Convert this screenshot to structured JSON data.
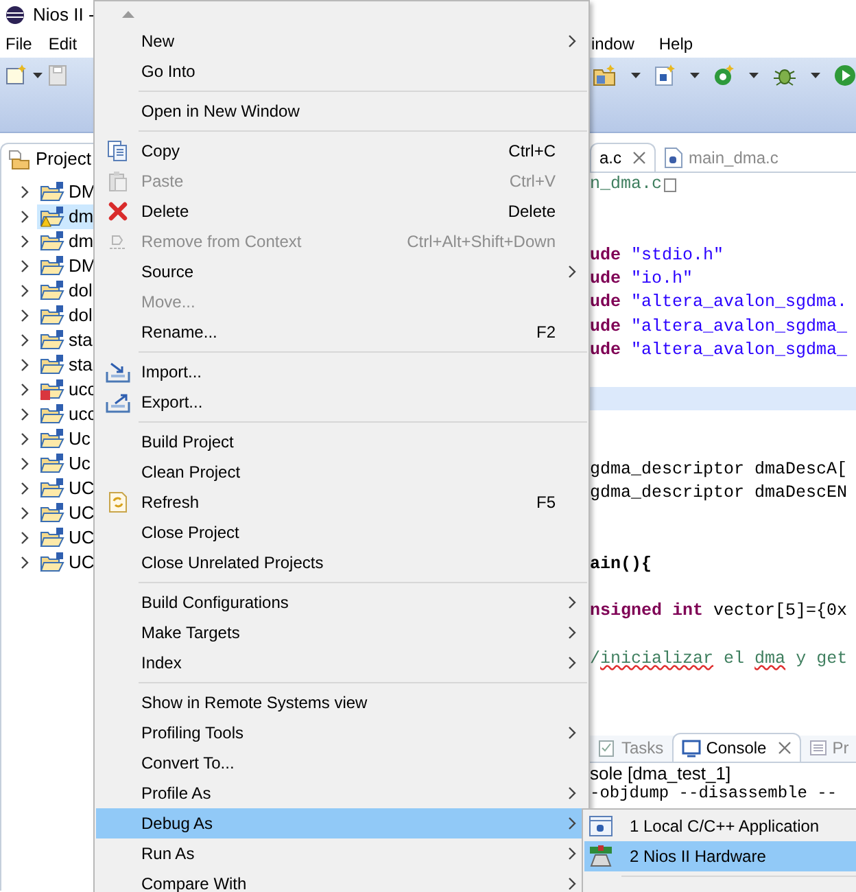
{
  "window": {
    "title": "Nios II -"
  },
  "menubar": [
    {
      "label": "File"
    },
    {
      "label": "Edit"
    },
    {
      "label": "indow"
    },
    {
      "label": "Help"
    }
  ],
  "project_panel": {
    "tab": "Project",
    "tree": [
      {
        "label": "DM",
        "selected": false,
        "kind": "normal"
      },
      {
        "label": "dm",
        "selected": true,
        "kind": "warning"
      },
      {
        "label": "dm",
        "selected": false,
        "kind": "normal"
      },
      {
        "label": "DM",
        "selected": false,
        "kind": "normal"
      },
      {
        "label": "dol",
        "selected": false,
        "kind": "normal"
      },
      {
        "label": "dol",
        "selected": false,
        "kind": "normal"
      },
      {
        "label": "sta",
        "selected": false,
        "kind": "normal"
      },
      {
        "label": "sta",
        "selected": false,
        "kind": "normal"
      },
      {
        "label": "ucc",
        "selected": false,
        "kind": "error"
      },
      {
        "label": "ucc",
        "selected": false,
        "kind": "normal"
      },
      {
        "label": "Uc",
        "selected": false,
        "kind": "normal"
      },
      {
        "label": "Uc",
        "selected": false,
        "kind": "normal"
      },
      {
        "label": "UC",
        "selected": false,
        "kind": "normal"
      },
      {
        "label": "UC",
        "selected": false,
        "kind": "normal"
      },
      {
        "label": "UC",
        "selected": false,
        "kind": "normal"
      },
      {
        "label": "UC",
        "selected": false,
        "kind": "normal"
      }
    ]
  },
  "editor": {
    "tabs": [
      {
        "label": "a.c",
        "selected": true
      },
      {
        "label": "main_dma.c",
        "selected": false
      }
    ],
    "lines": [
      {
        "kind": "folded",
        "highlighted": false,
        "segments": [
          {
            "text": "n_dma.c",
            "kind": "comment"
          }
        ]
      },
      {
        "kind": "blank",
        "highlighted": false
      },
      {
        "kind": "blank",
        "highlighted": false
      },
      {
        "kind": "code",
        "highlighted": false,
        "segments": [
          {
            "text": "ude",
            "kind": "keyword"
          },
          {
            "text": " \"stdio.h\"",
            "kind": "string"
          }
        ]
      },
      {
        "kind": "code",
        "highlighted": false,
        "segments": [
          {
            "text": "ude",
            "kind": "keyword"
          },
          {
            "text": " \"io.h\"",
            "kind": "string"
          }
        ]
      },
      {
        "kind": "code",
        "highlighted": false,
        "segments": [
          {
            "text": "ude",
            "kind": "keyword"
          },
          {
            "text": " \"altera_avalon_sgdma.",
            "kind": "string"
          }
        ]
      },
      {
        "kind": "code",
        "highlighted": false,
        "segments": [
          {
            "text": "ude",
            "kind": "keyword"
          },
          {
            "text": " \"altera_avalon_sgdma_",
            "kind": "string"
          }
        ]
      },
      {
        "kind": "code",
        "highlighted": false,
        "segments": [
          {
            "text": "ude",
            "kind": "keyword"
          },
          {
            "text": " \"altera_avalon_sgdma_",
            "kind": "string"
          }
        ]
      },
      {
        "kind": "blank",
        "highlighted": false
      },
      {
        "kind": "blank",
        "highlighted": true
      },
      {
        "kind": "blank",
        "highlighted": false
      },
      {
        "kind": "blank",
        "highlighted": false
      },
      {
        "kind": "code",
        "highlighted": false,
        "segments": [
          {
            "text": "gdma_descriptor dmaDescA[",
            "kind": "plain"
          }
        ]
      },
      {
        "kind": "code",
        "highlighted": false,
        "segments": [
          {
            "text": "gdma_descriptor dmaDescEN",
            "kind": "plain"
          }
        ]
      },
      {
        "kind": "blank",
        "highlighted": false
      },
      {
        "kind": "blank",
        "highlighted": false
      },
      {
        "kind": "code",
        "highlighted": false,
        "segments": [
          {
            "text": "ain(){",
            "kind": "bold"
          }
        ]
      },
      {
        "kind": "blank",
        "highlighted": false
      },
      {
        "kind": "code",
        "highlighted": false,
        "segments": [
          {
            "text": "nsigned int",
            "kind": "keyword"
          },
          {
            "text": " vector[5]={0x",
            "kind": "plain"
          }
        ]
      },
      {
        "kind": "blank",
        "highlighted": false
      },
      {
        "kind": "code",
        "highlighted": false,
        "segments": [
          {
            "text": "/",
            "kind": "comment"
          },
          {
            "text": "inicializar",
            "kind": "misspelled"
          },
          {
            "text": " el ",
            "kind": "comment"
          },
          {
            "text": "dma",
            "kind": "misspelled"
          },
          {
            "text": " y get",
            "kind": "comment"
          }
        ]
      }
    ]
  },
  "bottom_panel": {
    "tabs": [
      {
        "label": "Tasks",
        "selected": false
      },
      {
        "label": "Console",
        "selected": true
      },
      {
        "label": "Pr",
        "selected": false
      }
    ],
    "console_title": "sole [dma_test_1]",
    "console_lines": [
      "-objdump --disassemble --"
    ]
  },
  "context_menu": {
    "items": [
      {
        "kind": "item",
        "label": "New",
        "submenu": true,
        "disabled": false,
        "selected": false
      },
      {
        "kind": "item",
        "label": "Go Into",
        "submenu": false,
        "disabled": false,
        "selected": false
      },
      {
        "kind": "separator"
      },
      {
        "kind": "item",
        "label": "Open in New Window",
        "submenu": false,
        "disabled": false,
        "selected": false
      },
      {
        "kind": "separator"
      },
      {
        "kind": "item",
        "label": "Copy",
        "shortcut": "Ctrl+C",
        "submenu": false,
        "disabled": false,
        "selected": false
      },
      {
        "kind": "item",
        "label": "Paste",
        "shortcut": "Ctrl+V",
        "submenu": false,
        "disabled": true,
        "selected": false
      },
      {
        "kind": "item",
        "label": "Delete",
        "shortcut": "Delete",
        "submenu": false,
        "disabled": false,
        "selected": false
      },
      {
        "kind": "item",
        "label": "Remove from Context",
        "shortcut": "Ctrl+Alt+Shift+Down",
        "submenu": false,
        "disabled": true,
        "selected": false
      },
      {
        "kind": "item",
        "label": "Source",
        "submenu": true,
        "disabled": false,
        "selected": false
      },
      {
        "kind": "item",
        "label": "Move...",
        "submenu": false,
        "disabled": true,
        "selected": false
      },
      {
        "kind": "item",
        "label": "Rename...",
        "shortcut": "F2",
        "submenu": false,
        "disabled": false,
        "selected": false
      },
      {
        "kind": "separator"
      },
      {
        "kind": "item",
        "label": "Import...",
        "submenu": false,
        "disabled": false,
        "selected": false
      },
      {
        "kind": "item",
        "label": "Export...",
        "submenu": false,
        "disabled": false,
        "selected": false
      },
      {
        "kind": "separator"
      },
      {
        "kind": "item",
        "label": "Build Project",
        "submenu": false,
        "disabled": false,
        "selected": false
      },
      {
        "kind": "item",
        "label": "Clean Project",
        "submenu": false,
        "disabled": false,
        "selected": false
      },
      {
        "kind": "item",
        "label": "Refresh",
        "shortcut": "F5",
        "submenu": false,
        "disabled": false,
        "selected": false
      },
      {
        "kind": "item",
        "label": "Close Project",
        "submenu": false,
        "disabled": false,
        "selected": false
      },
      {
        "kind": "item",
        "label": "Close Unrelated Projects",
        "submenu": false,
        "disabled": false,
        "selected": false
      },
      {
        "kind": "separator"
      },
      {
        "kind": "item",
        "label": "Build Configurations",
        "submenu": true,
        "disabled": false,
        "selected": false
      },
      {
        "kind": "item",
        "label": "Make Targets",
        "submenu": true,
        "disabled": false,
        "selected": false
      },
      {
        "kind": "item",
        "label": "Index",
        "submenu": true,
        "disabled": false,
        "selected": false
      },
      {
        "kind": "separator"
      },
      {
        "kind": "item",
        "label": "Show in Remote Systems view",
        "submenu": false,
        "disabled": false,
        "selected": false
      },
      {
        "kind": "item",
        "label": "Profiling Tools",
        "submenu": true,
        "disabled": false,
        "selected": false
      },
      {
        "kind": "item",
        "label": "Convert To...",
        "submenu": false,
        "disabled": false,
        "selected": false
      },
      {
        "kind": "item",
        "label": "Profile As",
        "submenu": true,
        "disabled": false,
        "selected": false
      },
      {
        "kind": "item",
        "label": "Debug As",
        "submenu": true,
        "disabled": false,
        "selected": true
      },
      {
        "kind": "item",
        "label": "Run As",
        "submenu": true,
        "disabled": false,
        "selected": false
      },
      {
        "kind": "item",
        "label": "Compare With",
        "submenu": true,
        "disabled": false,
        "selected": false
      }
    ]
  },
  "submenu": {
    "items": [
      {
        "label": "1 Local C/C++ Application",
        "selected": false
      },
      {
        "label": "2 Nios II Hardware",
        "selected": true
      }
    ]
  }
}
